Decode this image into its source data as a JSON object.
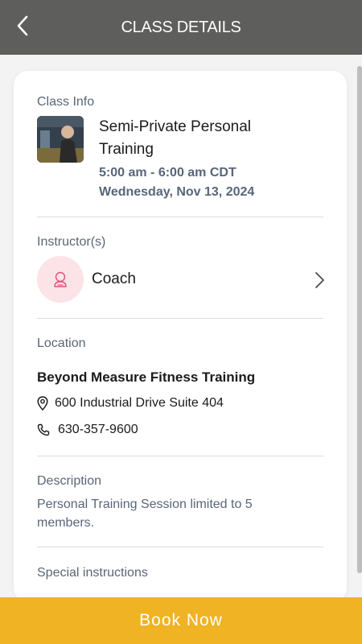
{
  "header": {
    "title": "CLASS DETAILS",
    "back_icon": "chevron-left-icon"
  },
  "class_info": {
    "section_label": "Class Info",
    "title": "Semi-Private Personal Training",
    "time": "5:00 am - 6:00 am CDT",
    "date": "Wednesday, Nov 13, 2024"
  },
  "instructor": {
    "section_label": "Instructor(s)",
    "name": "Coach",
    "avatar_icon": "person-outline-icon",
    "accent_color": "#e2527a"
  },
  "location": {
    "section_label": "Location",
    "name": "Beyond Measure Fitness Training",
    "address": "600 Industrial Drive Suite 404",
    "phone": "630-357-9600"
  },
  "description": {
    "section_label": "Description",
    "text": "Personal Training Session limited to 5 members."
  },
  "special_instructions": {
    "section_label": "Special instructions"
  },
  "footer": {
    "book_label": "Book Now",
    "button_color": "#f0b323"
  },
  "colors": {
    "header_bg": "#5e5e5c",
    "muted_text": "#586579"
  }
}
